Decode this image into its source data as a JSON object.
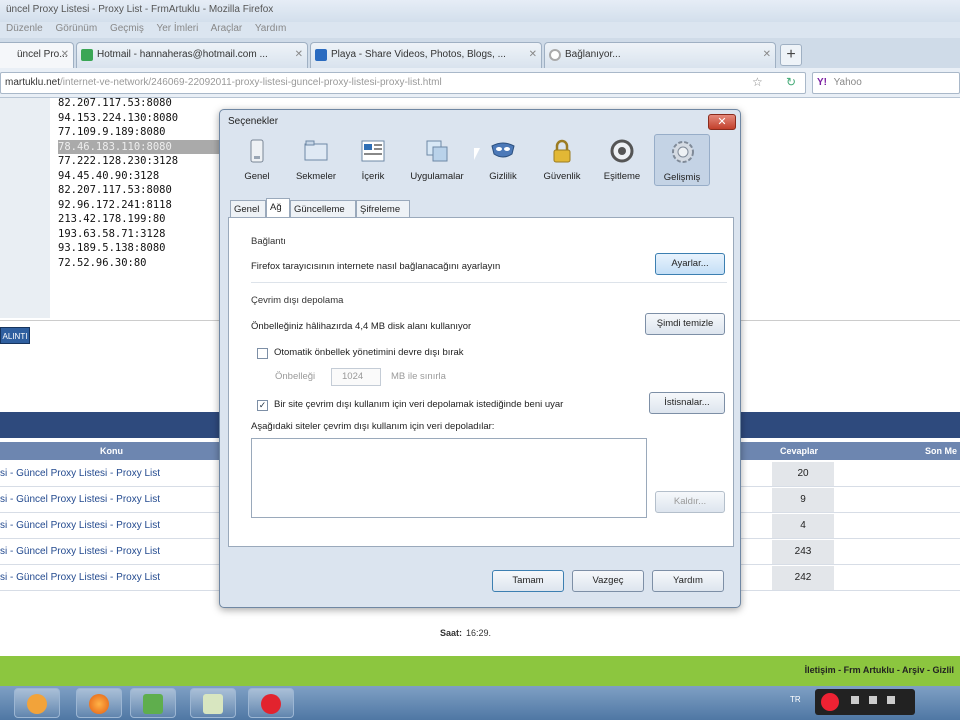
{
  "window": {
    "title": "üncel Proxy Listesi - Proxy List - FrmArtuklu - Mozilla Firefox"
  },
  "menubar": [
    "Düzenle",
    "Görünüm",
    "Geçmiş",
    "Yer İmleri",
    "Araçlar",
    "Yardım"
  ],
  "tabs": [
    {
      "label": "üncel Pro...",
      "active": true,
      "icon_color": "#d9a441"
    },
    {
      "label": "Hotmail - hannaheras@hotmail.com ...",
      "active": false,
      "icon_color": "#3aa655"
    },
    {
      "label": "Playa - Share Videos, Photos, Blogs, ...",
      "active": false,
      "icon_color": "#2a6bc0"
    },
    {
      "label": "Bağlanıyor...",
      "active": false,
      "icon_color": "#aaaaaa"
    }
  ],
  "navbar": {
    "url_host": "martuklu.net",
    "url_path": "/internet-ve-network/246069-22092011-proxy-listesi-guncel-proxy-listesi-proxy-list.html",
    "search_placeholder": "Yahoo",
    "search_logo": "Y!"
  },
  "page": {
    "proxies": [
      "82.207.117.53:8080",
      "94.153.224.130:8080",
      "77.109.9.189:8080",
      "78.46.183.110:8080",
      "77.222.128.230:3128",
      "94.45.40.90:3128",
      "82.207.117.53:8080",
      "92.96.172.241:8118",
      "213.42.178.199:80",
      "193.63.58.71:3128",
      "93.189.5.138:8080",
      "72.52.96.30:80"
    ],
    "highlight_index": 3,
    "quote_label": "ALINTI",
    "table_headers": {
      "konu": "Konu",
      "cevaplar": "Cevaplar",
      "son": "Son Me"
    },
    "rows": [
      {
        "topic": "si - Güncel Proxy Listesi - Proxy List",
        "count": "20"
      },
      {
        "topic": "si - Güncel Proxy Listesi - Proxy List",
        "count": "9"
      },
      {
        "topic": "si - Güncel Proxy Listesi - Proxy List",
        "count": "4"
      },
      {
        "topic": "si - Güncel Proxy Listesi - Proxy List",
        "count": "243"
      },
      {
        "topic": "si - Güncel Proxy Listesi - Proxy List",
        "count": "242"
      }
    ],
    "saat_label": "Saat:",
    "saat_value": "16:29.",
    "footer_links": "İletişim - Frm Artuklu - Arşiv - Gizlil"
  },
  "taskbar": {
    "tray_lang": "TR"
  },
  "dialog": {
    "title": "Seçenekler",
    "close": "✕",
    "categories": [
      {
        "label": "Genel",
        "icon": "general-icon",
        "selected": false
      },
      {
        "label": "Sekmeler",
        "icon": "tabs-icon",
        "selected": false
      },
      {
        "label": "İçerik",
        "icon": "content-icon",
        "selected": false
      },
      {
        "label": "Uygulamalar",
        "icon": "applications-icon",
        "selected": false
      },
      {
        "label": "Gizlilik",
        "icon": "privacy-icon",
        "selected": false
      },
      {
        "label": "Güvenlik",
        "icon": "security-icon",
        "selected": false
      },
      {
        "label": "Eşitleme",
        "icon": "sync-icon",
        "selected": false
      },
      {
        "label": "Gelişmiş",
        "icon": "advanced-icon",
        "selected": true
      }
    ],
    "subtabs": [
      {
        "label": "Genel",
        "selected": false
      },
      {
        "label": "Ağ",
        "selected": true
      },
      {
        "label": "Güncelleme",
        "selected": false
      },
      {
        "label": "Şifreleme",
        "selected": false
      }
    ],
    "connection": {
      "group": "Bağlantı",
      "desc": "Firefox tarayıcısının internete nasıl bağlanacağını ayarlayın",
      "settings_button": "Ayarlar..."
    },
    "offline": {
      "group": "Çevrim dışı depolama",
      "cache_usage": "Önbelleğiniz hâlihazırda 4,4 MB disk alanı kullanıyor",
      "clear_now": "Şimdi temizle",
      "override_cache": "Otomatik önbellek yönetimini devre dışı bırak",
      "override_checked": false,
      "limit_label": "Önbelleği",
      "limit_value": "1024",
      "limit_unit": "MB ile sınırla",
      "warn_label": "Bir site çevrim dışı kullanım için veri depolamak istediğinde beni uyar",
      "warn_checked": true,
      "exceptions": "İstisnalar...",
      "list_label": "Aşağıdaki siteler çevrim dışı kullanım için veri depoladılar:",
      "remove": "Kaldır..."
    },
    "buttons": {
      "ok": "Tamam",
      "cancel": "Vazgeç",
      "help": "Yardım"
    }
  }
}
